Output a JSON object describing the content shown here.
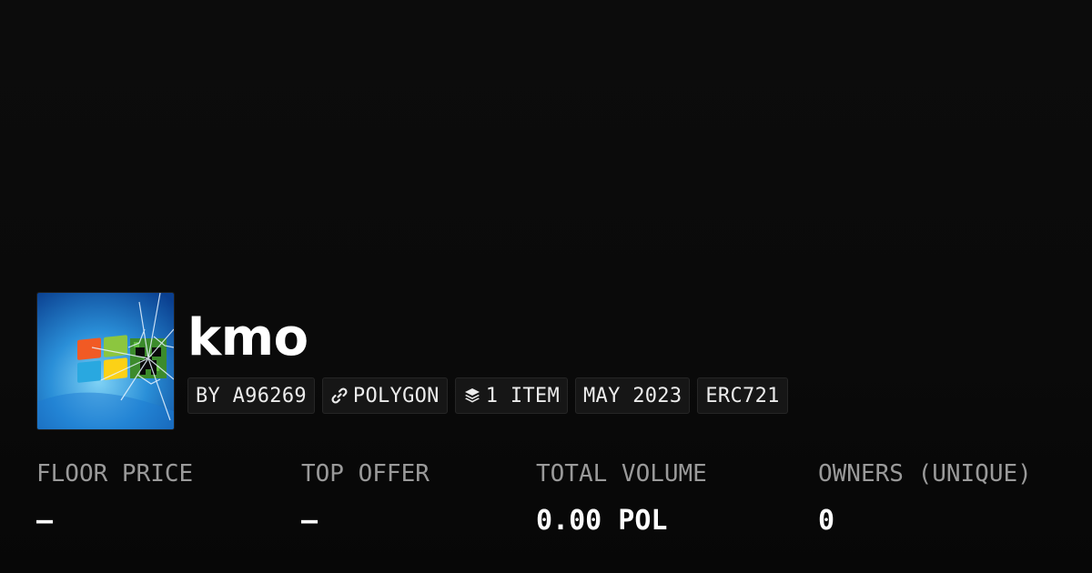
{
  "collection": {
    "name": "kmo",
    "image": "windows-logo-creeper-cracked-screen"
  },
  "chips": {
    "creator": "BY A96269",
    "chain": "POLYGON",
    "chain_icon": "link-icon",
    "items": "1 ITEM",
    "items_icon": "layers-icon",
    "date": "MAY 2023",
    "standard": "ERC721"
  },
  "stats": {
    "floor_price": {
      "label": "FLOOR PRICE",
      "value": "–"
    },
    "top_offer": {
      "label": "TOP OFFER",
      "value": "–"
    },
    "total_volume": {
      "label": "TOTAL VOLUME",
      "value": "0.00 POL"
    },
    "owners": {
      "label": "OWNERS (UNIQUE)",
      "value": "0"
    }
  },
  "colors": {
    "background": "#0a0a0a",
    "chip_background": "#161616",
    "chip_border": "#262626",
    "label_gray": "#9a9a9a",
    "text": "#ffffff"
  }
}
